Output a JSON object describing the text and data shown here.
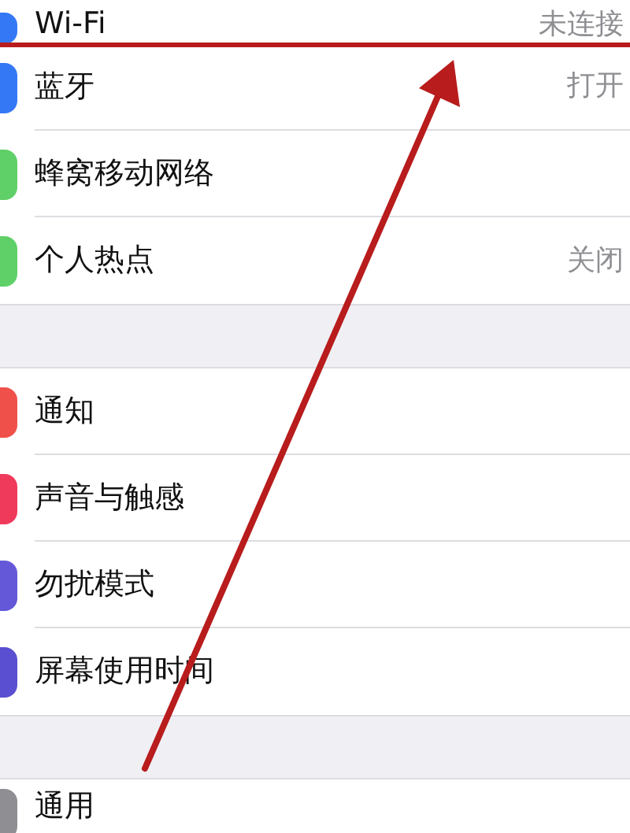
{
  "sections": [
    {
      "rows": [
        {
          "label": "Wi-Fi",
          "value": "未连接",
          "color": "#3478f6"
        },
        {
          "label": "蓝牙",
          "value": "打开",
          "color": "#3478f6"
        },
        {
          "label": "蜂窝移动网络",
          "color": "#5fd068"
        },
        {
          "label": "个人热点",
          "value": "关闭",
          "color": "#5fd068"
        }
      ]
    },
    {
      "rows": [
        {
          "label": "通知",
          "color": "#f0504a"
        },
        {
          "label": "声音与触感",
          "color": "#f03a5c"
        },
        {
          "label": "勿扰模式",
          "color": "#6458d8"
        },
        {
          "label": "屏幕使用时间",
          "color": "#5a4fd0"
        }
      ]
    },
    {
      "rows": [
        {
          "label": "通用",
          "color": "#8e8e93"
        }
      ]
    }
  ]
}
